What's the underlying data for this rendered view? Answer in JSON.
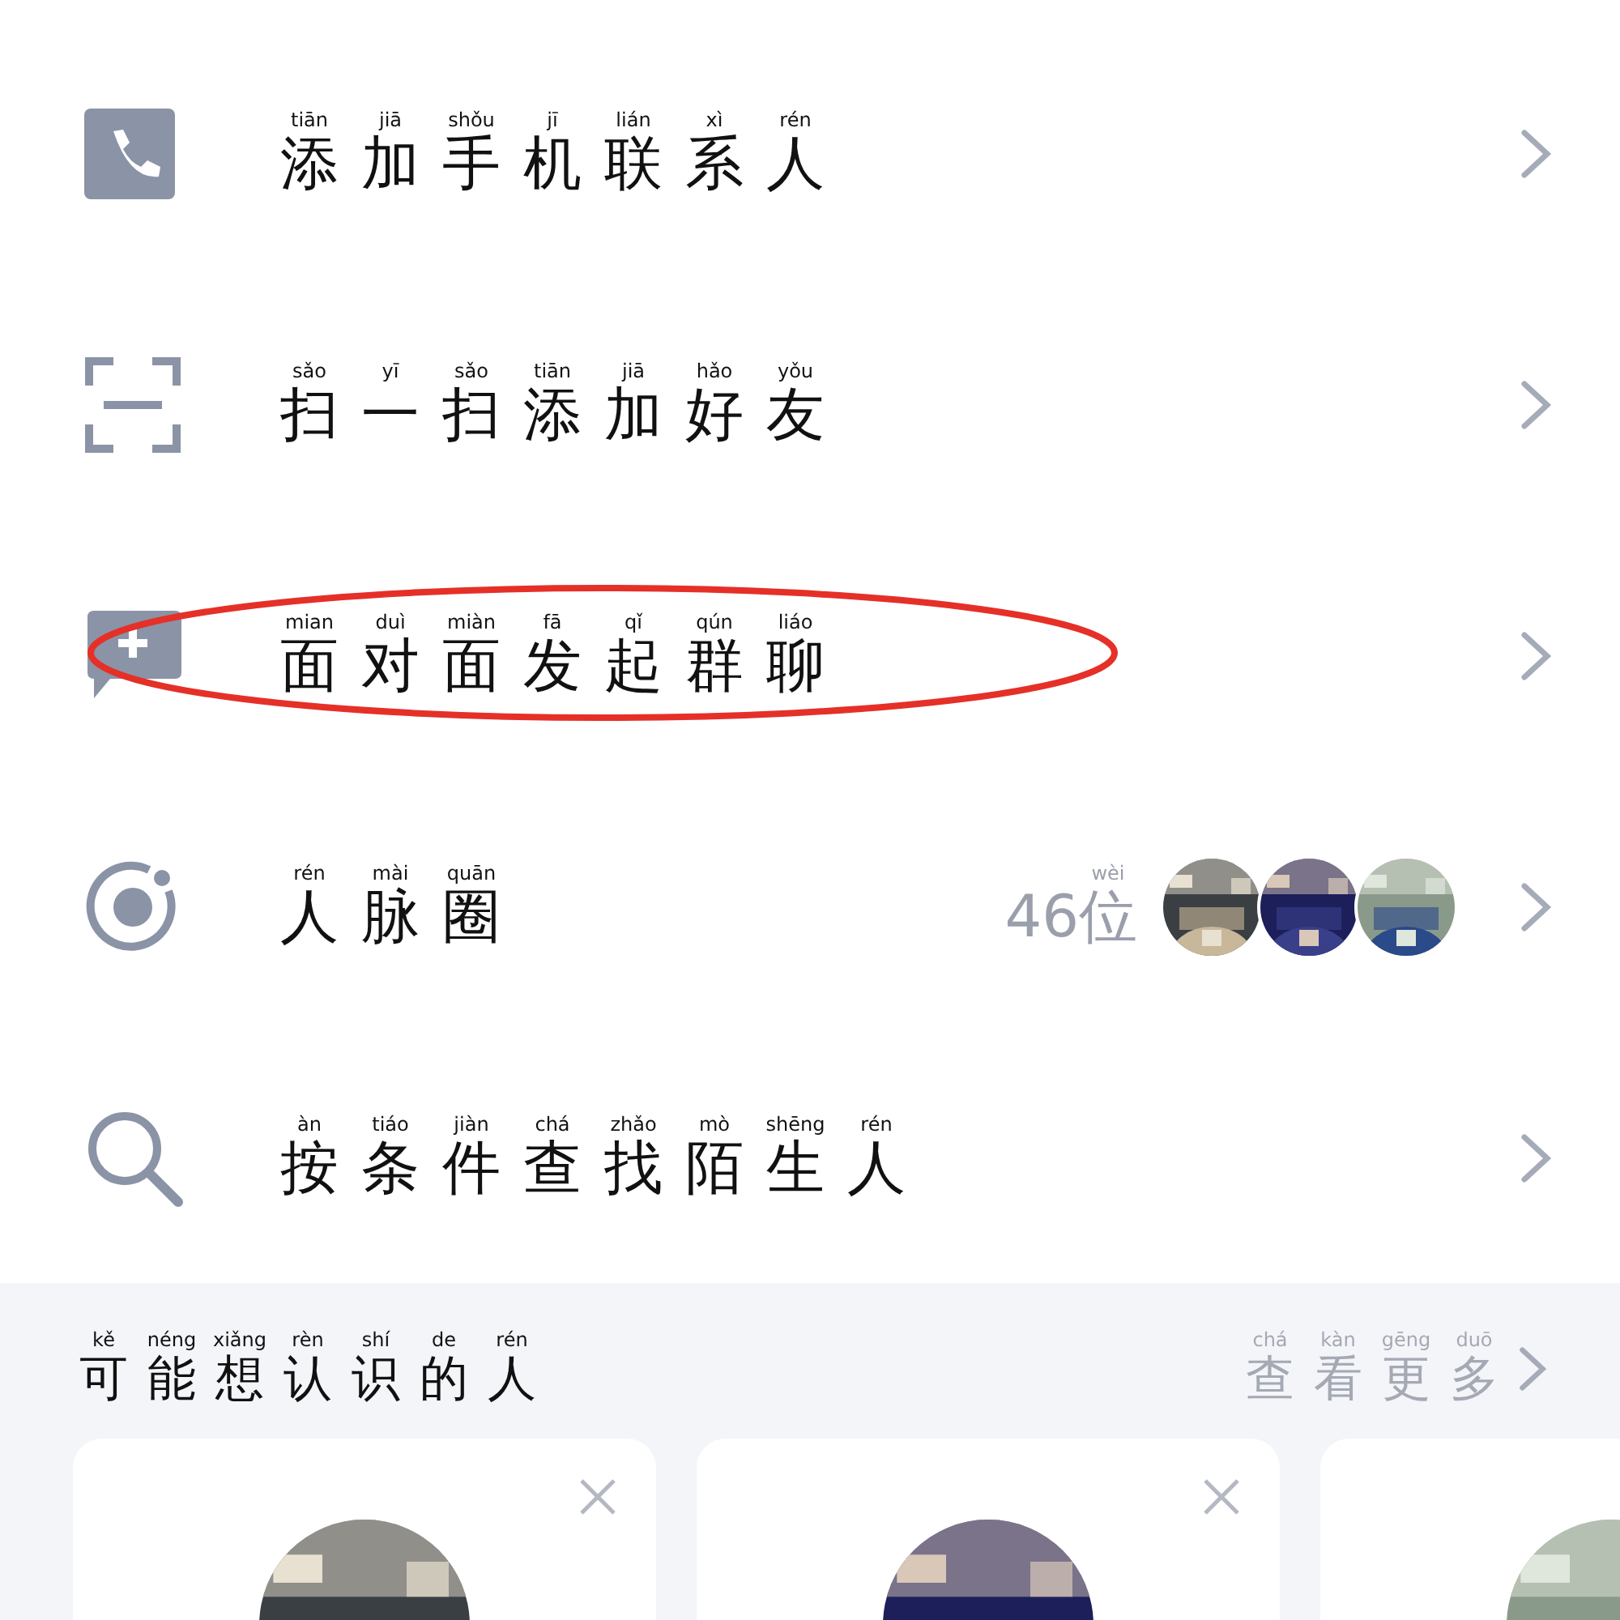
{
  "menu": [
    {
      "kind": "phone",
      "circled": false,
      "title": [
        {
          "char": "添",
          "pinyin": "tiān"
        },
        {
          "char": "加",
          "pinyin": "jiā"
        },
        {
          "char": "手",
          "pinyin": "shǒu"
        },
        {
          "char": "机",
          "pinyin": "jī"
        },
        {
          "char": "联",
          "pinyin": "lián"
        },
        {
          "char": "系",
          "pinyin": "xì"
        },
        {
          "char": "人",
          "pinyin": "rén"
        }
      ]
    },
    {
      "kind": "scan",
      "circled": false,
      "title": [
        {
          "char": "扫",
          "pinyin": "sǎo"
        },
        {
          "char": "一",
          "pinyin": "yī"
        },
        {
          "char": "扫",
          "pinyin": "sǎo"
        },
        {
          "char": "添",
          "pinyin": "tiān"
        },
        {
          "char": "加",
          "pinyin": "jiā"
        },
        {
          "char": "好",
          "pinyin": "hǎo"
        },
        {
          "char": "友",
          "pinyin": "yǒu"
        }
      ]
    },
    {
      "kind": "chat-plus",
      "circled": true,
      "title": [
        {
          "char": "面",
          "pinyin": "mian"
        },
        {
          "char": "对",
          "pinyin": "duì"
        },
        {
          "char": "面",
          "pinyin": "miàn"
        },
        {
          "char": "发",
          "pinyin": "fā"
        },
        {
          "char": "起",
          "pinyin": "qǐ"
        },
        {
          "char": "群",
          "pinyin": "qún"
        },
        {
          "char": "聊",
          "pinyin": "liáo"
        }
      ]
    },
    {
      "kind": "orbit",
      "circled": false,
      "title": [
        {
          "char": "人",
          "pinyin": "rén"
        },
        {
          "char": "脉",
          "pinyin": "mài"
        },
        {
          "char": "圈",
          "pinyin": "quān"
        }
      ],
      "count": [
        {
          "char": "46"
        },
        {
          "char": "位",
          "pinyin": "wèi"
        }
      ],
      "avatars": [
        {
          "kind": "picture"
        },
        {
          "kind": "picture"
        },
        {
          "kind": "picture"
        }
      ]
    },
    {
      "kind": "search",
      "circled": false,
      "title": [
        {
          "char": "按",
          "pinyin": "àn"
        },
        {
          "char": "条",
          "pinyin": "tiáo"
        },
        {
          "char": "件",
          "pinyin": "jiàn"
        },
        {
          "char": "查",
          "pinyin": "chá"
        },
        {
          "char": "找",
          "pinyin": "zhǎo"
        },
        {
          "char": "陌",
          "pinyin": "mò"
        },
        {
          "char": "生",
          "pinyin": "shēng"
        },
        {
          "char": "人",
          "pinyin": "rén"
        }
      ]
    }
  ],
  "suggestions": {
    "title": [
      {
        "char": "可",
        "pinyin": "kě"
      },
      {
        "char": "能",
        "pinyin": "néng"
      },
      {
        "char": "想",
        "pinyin": "xiǎng"
      },
      {
        "char": "认",
        "pinyin": "rèn"
      },
      {
        "char": "识",
        "pinyin": "shí"
      },
      {
        "char": "的",
        "pinyin": "de"
      },
      {
        "char": "人",
        "pinyin": "rén"
      }
    ],
    "more": [
      {
        "char": "查",
        "pinyin": "chá"
      },
      {
        "char": "看",
        "pinyin": "kàn"
      },
      {
        "char": "更",
        "pinyin": "gēng"
      },
      {
        "char": "多",
        "pinyin": "duō"
      }
    ],
    "cards": [
      {
        "closable": true,
        "avatar": {
          "kind": "picture"
        }
      },
      {
        "closable": true,
        "avatar": {
          "kind": "picture"
        }
      },
      {
        "closable": false,
        "avatar": {
          "kind": "picture"
        }
      }
    ]
  }
}
